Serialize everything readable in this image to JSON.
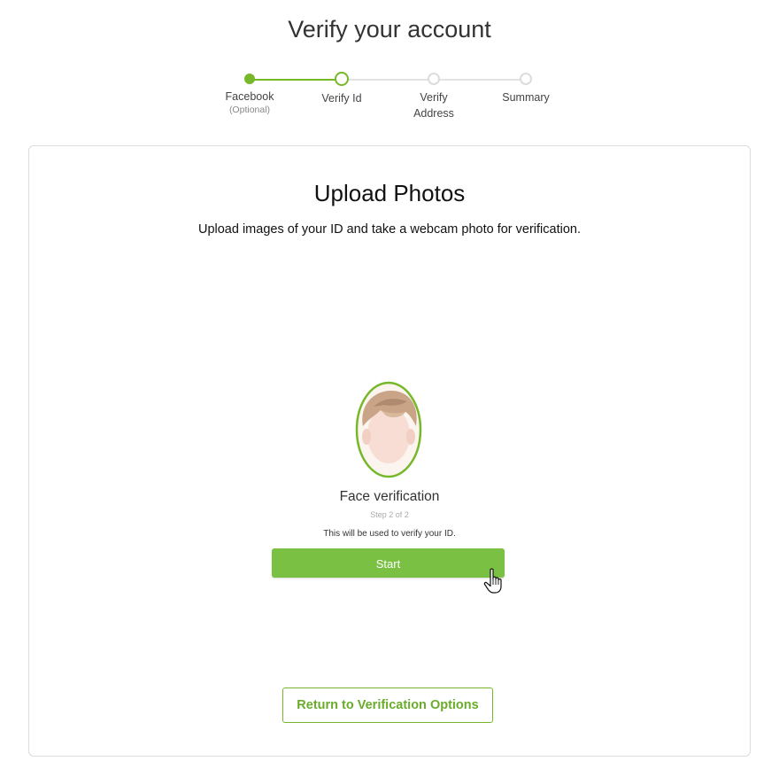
{
  "page": {
    "title": "Verify your account"
  },
  "stepper": {
    "steps": [
      {
        "label": "Facebook",
        "sub": "(Optional)",
        "state": "done"
      },
      {
        "label": "Verify Id",
        "sub": "",
        "state": "current"
      },
      {
        "label": "Verify Address",
        "sub": "",
        "state": "pending"
      },
      {
        "label": "Summary",
        "sub": "",
        "state": "pending"
      }
    ]
  },
  "card": {
    "title": "Upload Photos",
    "description": "Upload images of your ID and take a webcam photo for verification.",
    "face": {
      "title": "Face verification",
      "step": "Step 2 of 2",
      "note": "This will be used to verify your ID.",
      "illustration": "face-avatar"
    },
    "start_label": "Start",
    "return_label": "Return to Verification Options"
  },
  "colors": {
    "accent": "#76b82a",
    "button": "#7ac143",
    "border": "#dddddd"
  },
  "icons": {
    "cursor": "hand-pointer-icon"
  }
}
